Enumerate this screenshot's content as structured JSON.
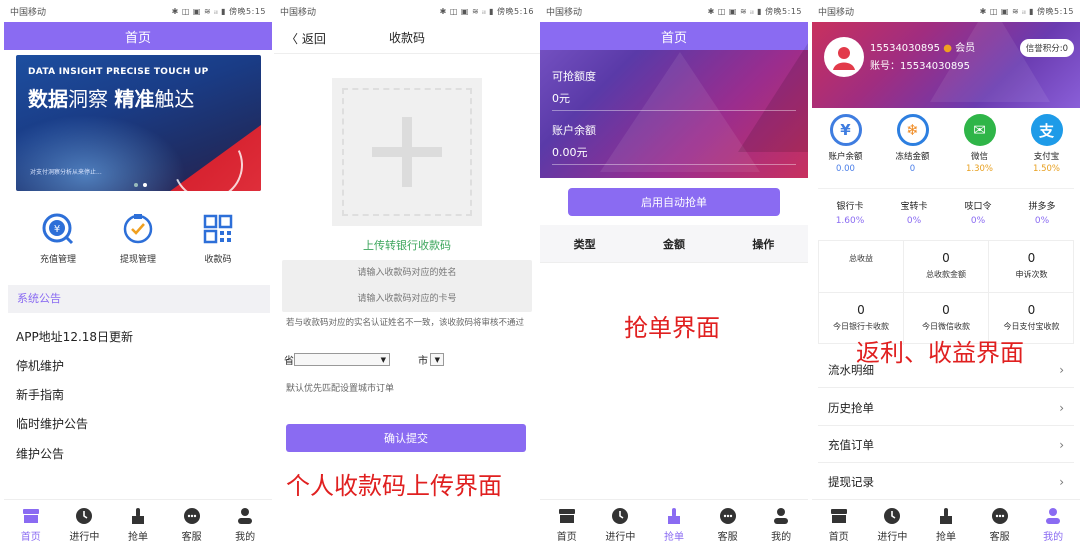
{
  "status": {
    "carrier": "中国移动",
    "icons": "✱ ◫ ▣ ≋ ᵢₗ ▮",
    "time1": "傍晚5:15",
    "time2": "傍晚5:16"
  },
  "p1": {
    "title": "首页",
    "banner": {
      "en": "DATA INSIGHT PRECISE TOUCH UP",
      "cn1": "数据",
      "cn2": "洞察 ",
      "cn3": "精准",
      "cn4": "触达",
      "small": "对支付洞察分析从来停止..."
    },
    "icons": [
      {
        "label": "充值管理"
      },
      {
        "label": "提现管理"
      },
      {
        "label": "收款码"
      }
    ],
    "section": "系统公告",
    "notices": [
      "APP地址12.18日更新",
      "停机维护",
      "新手指南",
      "临时维护公告",
      "维护公告"
    ]
  },
  "tabs": [
    "首页",
    "进行中",
    "抢单",
    "客服",
    "我的"
  ],
  "p2": {
    "back": "〈 返回",
    "title": "收款码",
    "upload": "上传转银行收款码",
    "name_ph": "请输入收款码对应的姓名",
    "card_ph": "请输入收款码对应的卡号",
    "warn": "若与收款码对应的实名认证姓名不一致，该收款码将审核不通过",
    "province": "省",
    "city": "市",
    "default": "默认优先匹配设置城市订单",
    "submit": "确认提交",
    "caption": "个人收款码上传界面"
  },
  "p3": {
    "title": "首页",
    "quota_label": "可抢额度",
    "quota_value": "0元",
    "balance_label": "账户余额",
    "balance_value": "0.00元",
    "auto_btn": "启用自动抢单",
    "cols": [
      "类型",
      "金额",
      "操作"
    ],
    "caption": "抢单界面"
  },
  "p4": {
    "phone": "15534030895",
    "member": "会员",
    "account": "账号：15534030895",
    "credit": "信誉积分:0",
    "pay": [
      {
        "label": "账户余额",
        "value": "0.00",
        "color": "#3f7de0",
        "glyph": "¥"
      },
      {
        "label": "冻结金额",
        "value": "0",
        "color": "#2d7fe0",
        "glyph": "❄"
      },
      {
        "label": "微信",
        "value": "1.30%",
        "color": "#2fb548",
        "glyph": "✉"
      },
      {
        "label": "支付宝",
        "value": "1.50%",
        "color": "#1e9be8",
        "glyph": "支"
      }
    ],
    "rates": [
      {
        "label": "银行卡",
        "value": "1.60%"
      },
      {
        "label": "宝转卡",
        "value": "0%"
      },
      {
        "label": "吱口令",
        "value": "0%"
      },
      {
        "label": "拼多多",
        "value": "0%"
      }
    ],
    "stats": [
      {
        "n": "",
        "l": "总收益"
      },
      {
        "n": "0",
        "l": "总收款金额"
      },
      {
        "n": "0",
        "l": "申诉次数"
      },
      {
        "n": "0",
        "l": "今日银行卡收款"
      },
      {
        "n": "0",
        "l": "今日微信收款"
      },
      {
        "n": "0",
        "l": "今日支付宝收款"
      }
    ],
    "menu": [
      "流水明细",
      "历史抢单",
      "充值订单",
      "提现记录"
    ],
    "caption": "返利、收益界面"
  }
}
